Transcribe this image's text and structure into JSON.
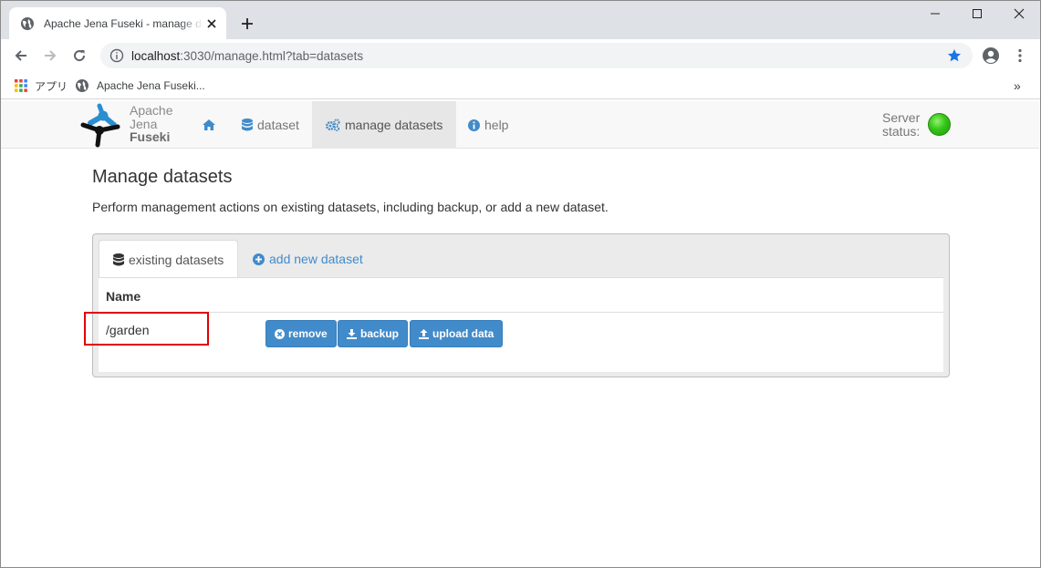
{
  "browser": {
    "tab_title": "Apache Jena Fuseki - manage datasets",
    "url_host": "localhost",
    "url_rest": ":3030/manage.html?tab=datasets",
    "bookmarks": [
      {
        "label": "アプリ",
        "icon": "apps-grid-icon"
      },
      {
        "label": "Apache Jena Fuseki...",
        "icon": "globe-icon"
      }
    ],
    "overflow_label": "»"
  },
  "navbar": {
    "logo_lines": [
      "Apache",
      "Jena",
      "Fuseki"
    ],
    "items": [
      {
        "label": "",
        "icon": "home-icon"
      },
      {
        "label": "dataset",
        "icon": "database-icon"
      },
      {
        "label": "manage datasets",
        "icon": "cogs-icon"
      },
      {
        "label": "help",
        "icon": "info-circle-icon"
      }
    ],
    "server_status_line1": "Server",
    "server_status_line2": "status:",
    "status_color": "#35c419"
  },
  "main": {
    "title": "Manage datasets",
    "description": "Perform management actions on existing datasets, including backup, or add a new dataset.",
    "tabs": [
      {
        "label": "existing datasets",
        "icon": "database-icon",
        "active": true
      },
      {
        "label": "add new dataset",
        "icon": "plus-circle-icon",
        "active": false
      }
    ],
    "table": {
      "columns": [
        "Name"
      ],
      "rows": [
        {
          "name": "/garden",
          "actions": [
            "remove",
            "backup",
            "upload data"
          ]
        }
      ]
    }
  },
  "colors": {
    "accent": "#428bca",
    "highlight": "#e00000"
  }
}
